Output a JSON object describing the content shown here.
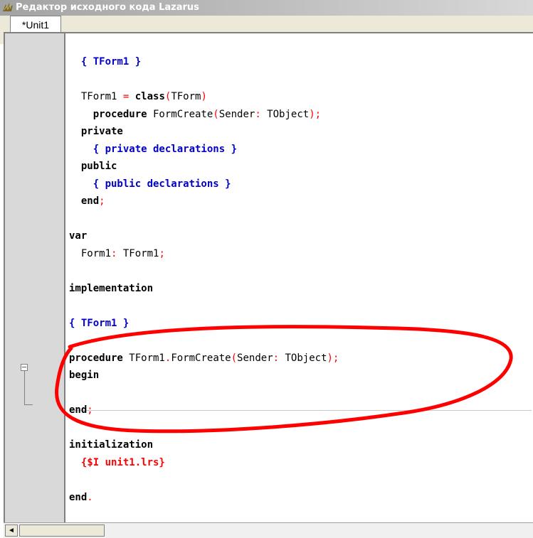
{
  "window": {
    "title": "Редактор исходного кода Lazarus",
    "icon": "lazarus-icon"
  },
  "tabs": [
    {
      "label": "*Unit1"
    }
  ],
  "code_lines": [
    [
      {
        "t": "  ",
        "c": ""
      },
      {
        "t": "{ TForm1 }",
        "c": "cm"
      }
    ],
    [],
    [
      {
        "t": "  TForm1 ",
        "c": ""
      },
      {
        "t": "=",
        "c": "sym"
      },
      {
        "t": " ",
        "c": ""
      },
      {
        "t": "class",
        "c": "kw"
      },
      {
        "t": "(",
        "c": "sym"
      },
      {
        "t": "TForm",
        "c": ""
      },
      {
        "t": ")",
        "c": "sym"
      }
    ],
    [
      {
        "t": "    ",
        "c": ""
      },
      {
        "t": "procedure",
        "c": "kw"
      },
      {
        "t": " FormCreate",
        "c": ""
      },
      {
        "t": "(",
        "c": "sym"
      },
      {
        "t": "Sender",
        "c": ""
      },
      {
        "t": ":",
        "c": "sym"
      },
      {
        "t": " TObject",
        "c": ""
      },
      {
        "t": ");",
        "c": "sym"
      }
    ],
    [
      {
        "t": "  ",
        "c": ""
      },
      {
        "t": "private",
        "c": "kw"
      }
    ],
    [
      {
        "t": "    ",
        "c": ""
      },
      {
        "t": "{ private declarations }",
        "c": "cm"
      }
    ],
    [
      {
        "t": "  ",
        "c": ""
      },
      {
        "t": "public",
        "c": "kw"
      }
    ],
    [
      {
        "t": "    ",
        "c": ""
      },
      {
        "t": "{ public declarations }",
        "c": "cm"
      }
    ],
    [
      {
        "t": "  ",
        "c": ""
      },
      {
        "t": "end",
        "c": "kw"
      },
      {
        "t": ";",
        "c": "sym"
      }
    ],
    [],
    [
      {
        "t": "var",
        "c": "kw"
      }
    ],
    [
      {
        "t": "  Form1",
        "c": ""
      },
      {
        "t": ":",
        "c": "sym"
      },
      {
        "t": " TForm1",
        "c": ""
      },
      {
        "t": ";",
        "c": "sym"
      }
    ],
    [],
    [
      {
        "t": "implementation",
        "c": "kw"
      }
    ],
    [],
    [
      {
        "t": "{ TForm1 }",
        "c": "cm"
      }
    ],
    [],
    [
      {
        "t": "procedure",
        "c": "kw"
      },
      {
        "t": " TForm1",
        "c": ""
      },
      {
        "t": ".",
        "c": "sym"
      },
      {
        "t": "FormCreate",
        "c": ""
      },
      {
        "t": "(",
        "c": "sym"
      },
      {
        "t": "Sender",
        "c": ""
      },
      {
        "t": ":",
        "c": "sym"
      },
      {
        "t": " TObject",
        "c": ""
      },
      {
        "t": ");",
        "c": "sym"
      }
    ],
    [
      {
        "t": "begin",
        "c": "kw"
      }
    ],
    [],
    [
      {
        "t": "end",
        "c": "kw"
      },
      {
        "t": ";",
        "c": "sym"
      }
    ],
    [],
    [
      {
        "t": "initialization",
        "c": "kw"
      }
    ],
    [
      {
        "t": "  ",
        "c": ""
      },
      {
        "t": "{$I unit1.lrs}",
        "c": "dir"
      }
    ],
    [],
    [
      {
        "t": "end",
        "c": "kw"
      },
      {
        "t": ".",
        "c": "sym"
      }
    ]
  ],
  "colors": {
    "comment": "#0000c8",
    "symbol": "#ff0000",
    "annotation": "#ff0000",
    "gutter": "#d9d9d9"
  },
  "scrollbar": {
    "left_arrow": "◄"
  }
}
